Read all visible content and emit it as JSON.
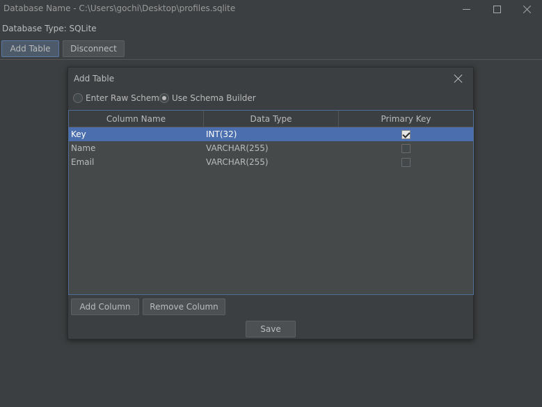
{
  "window": {
    "title": "Database Name - C:\\Users\\gochi\\Desktop\\profiles.sqlite"
  },
  "db": {
    "type_label": "Database Type: SQLite"
  },
  "toolbar": {
    "add_table_label": "Add Table",
    "disconnect_label": "Disconnect"
  },
  "dialog": {
    "title": "Add Table",
    "radio_raw": "Enter Raw Schema",
    "radio_builder": "Use Schema Builder",
    "selected_mode": "Use Schema Builder",
    "columns": [
      "Column Name",
      "Data Type",
      "Primary Key"
    ],
    "rows": [
      {
        "name": "Key",
        "type": "INT(32)",
        "primary": true
      },
      {
        "name": "Name",
        "type": "VARCHAR(255)",
        "primary": false
      },
      {
        "name": "Email",
        "type": "VARCHAR(255)",
        "primary": false
      }
    ],
    "add_column_label": "Add Column",
    "remove_column_label": "Remove Column",
    "save_label": "Save"
  },
  "colors": {
    "background": "#3c3f41",
    "selection": "#4b6eaf",
    "text": "#bbbbbb"
  }
}
